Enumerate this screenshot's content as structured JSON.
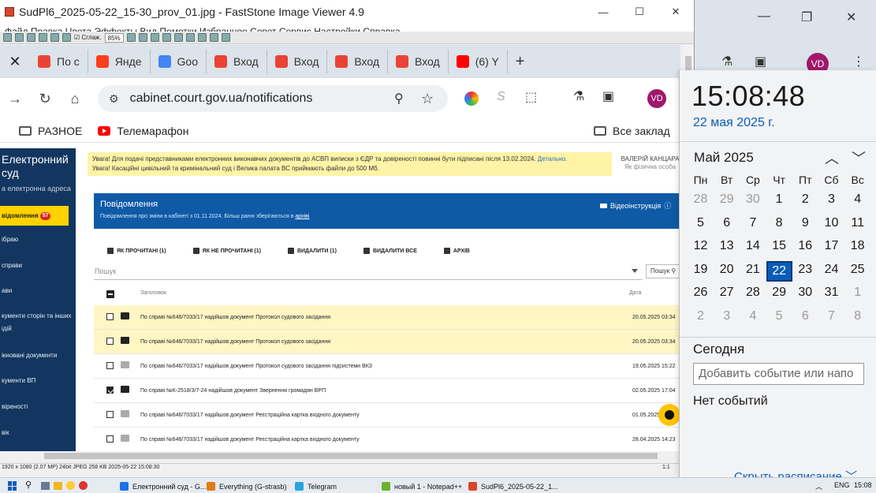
{
  "viewer": {
    "title": "SudPl6_2025-05-22_15-30_prov_01.jpg  -  FastStone Image Viewer 4.9",
    "menu": "Файл  Правка  Цвета  Эффекты  Вид  Пометки  Избранное  Совет  Сервис  Настройки  Справка",
    "smooth_label": "Сглаж.",
    "zoom": "85%",
    "status": "1920 x 1080 (2.07 MP)  24bit  JPEG   258 KB   2025-05-22 15:08:30",
    "status_ratio": "1:1"
  },
  "browser": {
    "tabs": [
      {
        "label": "По с",
        "icon": "gmail-icon",
        "color": "#ea4335"
      },
      {
        "label": "Янде",
        "icon": "yandex-icon",
        "color": "#fc3f1d"
      },
      {
        "label": "Goo",
        "icon": "google-icon",
        "color": "#4285f4"
      },
      {
        "label": "Вход",
        "icon": "gmail-icon",
        "color": "#ea4335"
      },
      {
        "label": "Вход",
        "icon": "gmail-icon",
        "color": "#ea4335"
      },
      {
        "label": "Вход",
        "icon": "gmail-icon",
        "color": "#ea4335"
      },
      {
        "label": "Вход",
        "icon": "gmail-icon",
        "color": "#ea4335"
      },
      {
        "label": "(6) Y",
        "icon": "youtube-icon",
        "color": "#ff0000"
      }
    ],
    "url": "cabinet.court.gov.ua/notifications",
    "bookmarks": [
      "РАЗНОЕ",
      "Телемарафон"
    ],
    "all_bookmarks": "Все заклад",
    "profile": "VD"
  },
  "court": {
    "brand_line1": "Електронний",
    "brand_line2": "суд",
    "brand_sub": "а електронна адреса",
    "active_item": "відомлення",
    "active_badge": "57",
    "sidebar_items": [
      "ібраю",
      "справи",
      "ави",
      "кументи сторін та інших",
      "ідій",
      "ікновані документи",
      "кументи ВП",
      "віреності",
      "вік"
    ],
    "warning_line1": "Увага! Для подачі представниками електронних виконавчих документів до АСВП виписки з ЄДР та довіреності повинні бути підписані після 13.02.2024.",
    "warning_link": "Детально.",
    "warning_line2": "Увага! Касаційні цивільний та кримінальний суд і Велика палата ВС приймають файли до 500 Мб.",
    "user_name": "ВАЛЕРІЙ КАНЦАРА",
    "user_role": "Як фізична особа",
    "panel_title": "Повідомлення",
    "panel_sub": "Повідомлення про зміни в кабінеті з 01.11.2024. Більш ранні зберігаються в",
    "panel_link": "архіві",
    "video_label": "Відеоінструкція",
    "actions": [
      "ЯК ПРОЧИТАНІ (1)",
      "ЯК НЕ ПРОЧИТАНІ (1)",
      "ВИДАЛИТИ (1)",
      "ВИДАЛИТИ ВСЕ",
      "АРХІВ"
    ],
    "search_placeholder": "Пошук",
    "search_button": "Пошук",
    "col_title": "Заголовок",
    "col_date": "Дата",
    "rows": [
      {
        "text": "По справі №646/7033/17 надійшов документ Протокол судового засідання",
        "date": "20.05.2025 03:34",
        "highlight": true,
        "checked": false
      },
      {
        "text": "По справі №646/7033/17 надійшов документ Протокол судового засідання",
        "date": "20.05.2025 03:34",
        "highlight": true,
        "checked": false
      },
      {
        "text": "По справі №646/7033/17 надійшов документ Протокол судового засідання підсистеми ВКЗ",
        "date": "19.05.2025 15:22",
        "highlight": false,
        "checked": false
      },
      {
        "text": "По справі №К-2518/3/7-24 надійшов документ Звернення громадян ВРП",
        "date": "02.05.2025 17:04",
        "highlight": false,
        "checked": true
      },
      {
        "text": "По справі №646/7033/17 надійшов документ Реєстраційна картка вхідного документу",
        "date": "01.05.2025",
        "highlight": false,
        "checked": false
      },
      {
        "text": "По справі №646/7033/17 надійшов документ Реєстраційна картка вхідного документу",
        "date": "28.04.2025 14:23",
        "highlight": false,
        "checked": false
      }
    ]
  },
  "clock": {
    "time": "15:08:48",
    "date": "22 мая 2025 г.",
    "month": "Май 2025",
    "weekdays": [
      "Пн",
      "Вт",
      "Ср",
      "Чт",
      "Пт",
      "Сб",
      "Вс"
    ],
    "weeks": [
      [
        "28",
        "29",
        "30",
        "1",
        "2",
        "3",
        "4"
      ],
      [
        "5",
        "6",
        "7",
        "8",
        "9",
        "10",
        "11"
      ],
      [
        "12",
        "13",
        "14",
        "15",
        "16",
        "17",
        "18"
      ],
      [
        "19",
        "20",
        "21",
        "22",
        "23",
        "24",
        "25"
      ],
      [
        "26",
        "27",
        "28",
        "29",
        "30",
        "31",
        "1"
      ],
      [
        "2",
        "3",
        "4",
        "5",
        "6",
        "7",
        "8"
      ]
    ],
    "today": "22",
    "today_heading": "Сегодня",
    "event_placeholder": "Добавить событие или напо",
    "no_events": "Нет событий",
    "hide_label": "Скрыть расписание"
  },
  "taskbar": {
    "apps": [
      {
        "label": "Електронний суд - G...",
        "color": "#1a73e8"
      },
      {
        "label": "Everything (G-strasb)",
        "color": "#e07a14"
      },
      {
        "label": "Telegram",
        "color": "#2aa3df"
      },
      {
        "label": "новый 1 - Notepad++",
        "color": "#6bb32e"
      },
      {
        "label": "SudPl6_2025-05-22_1...",
        "color": "#d8462a"
      }
    ],
    "lang": "ENG",
    "time": "15:08"
  }
}
